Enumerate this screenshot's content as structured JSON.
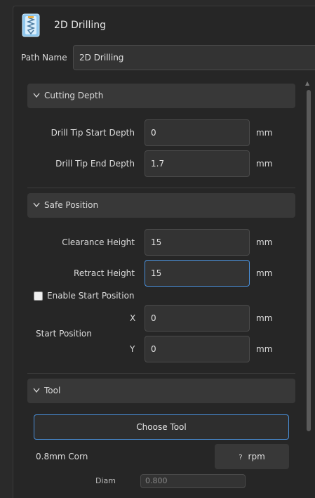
{
  "header": {
    "title": "2D Drilling",
    "icon": "drill-tool-icon"
  },
  "path": {
    "label": "Path Name",
    "value": "2D Drilling"
  },
  "cutting_depth": {
    "title": "Cutting Depth",
    "rows": [
      {
        "label": "Drill Tip Start Depth",
        "value": "0",
        "unit": "mm"
      },
      {
        "label": "Drill Tip End Depth",
        "value": "1.7",
        "unit": "mm"
      }
    ]
  },
  "safe_position": {
    "title": "Safe Position",
    "rows": [
      {
        "label": "Clearance Height",
        "value": "15",
        "unit": "mm"
      },
      {
        "label": "Retract Height",
        "value": "15",
        "unit": "mm"
      }
    ],
    "enable_start_label": "Enable Start Position",
    "start_position_label": "Start Position",
    "x_label": "X",
    "x_value": "0",
    "x_unit": "mm",
    "y_label": "Y",
    "y_value": "0",
    "y_unit": "mm"
  },
  "tool": {
    "title": "Tool",
    "choose_label": "Choose Tool",
    "tool_name": "0.8mm Corn",
    "rpm_value": "?",
    "rpm_unit": "rpm",
    "bottom_label": "Diam",
    "bottom_value": "0.800"
  }
}
